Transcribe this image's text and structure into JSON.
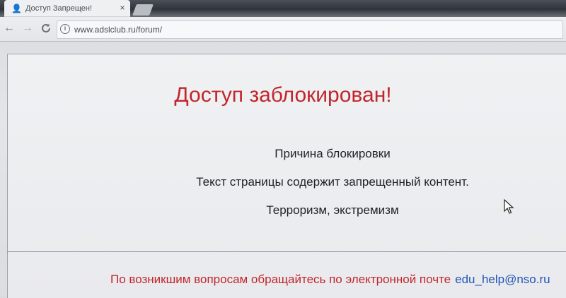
{
  "browser": {
    "tab": {
      "title": "Доступ Запрещен!",
      "favicon": "person-icon",
      "close": "×"
    },
    "toolbar": {
      "back": "←",
      "forward": "→",
      "reload": "C",
      "info": "i"
    },
    "url": "www.adslclub.ru/forum/"
  },
  "page": {
    "heading": "Доступ заблокирован!",
    "reason_label": "Причина блокировки",
    "reason_text": "Текст страницы содержит запрещенный контент.",
    "category": "Терроризм, экстремизм",
    "footer_text": "По возникшим вопросам обращайтесь по электронной почте",
    "footer_email": "edu_help@nso.ru"
  },
  "colors": {
    "heading": "#c0272d",
    "footer": "#c0272d",
    "link": "#1f56b4"
  }
}
